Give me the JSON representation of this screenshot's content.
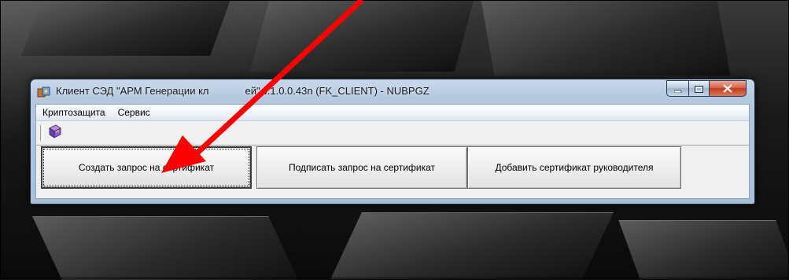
{
  "window": {
    "title": "Клиент СЭД \"АРМ Генерации ключей\" v.1.0.0.43n (FK_CLIENT) - NUBPGZ",
    "title_visible": "Клиент СЭД \"АРМ Генерации кл",
    "title_visible_tail": "ей\" v.1.0.0.43n (FK_CLIENT) - NUBPGZ"
  },
  "menu": {
    "items": [
      {
        "label": "Криптозащита"
      },
      {
        "label": "Сервис"
      }
    ]
  },
  "toolbar": {
    "icon": "book-icon"
  },
  "actions": {
    "create_request": "Создать запрос на сертификат",
    "sign_request": "Подписать запрос на сертификат",
    "add_manager_cert": "Добавить сертификат руководителя"
  },
  "colors": {
    "arrow": "#ff0000",
    "window_frame": "#b4c8df",
    "close_button": "#c23a1c"
  }
}
